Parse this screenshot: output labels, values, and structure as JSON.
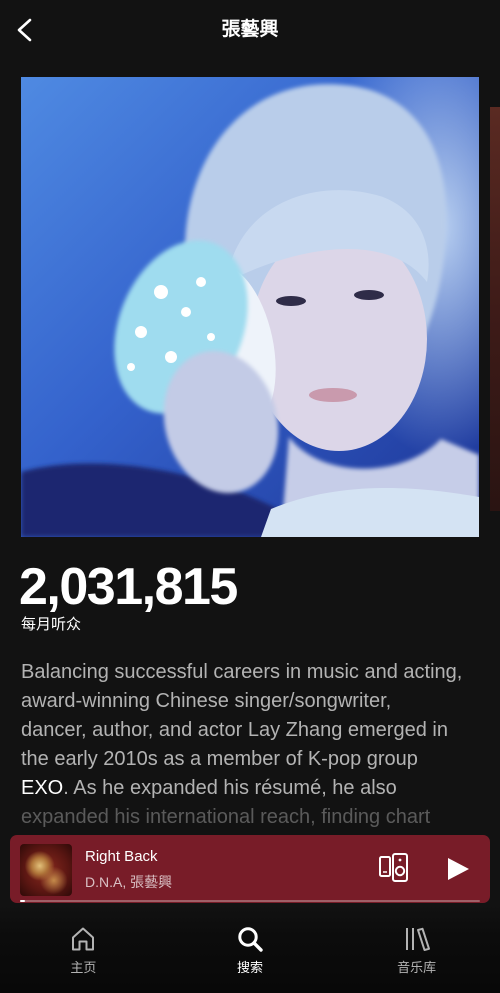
{
  "header": {
    "title": "張藝興",
    "back_icon": "chevron-left-icon"
  },
  "stats": {
    "monthly_listeners": "2,031,815",
    "monthly_listeners_label": "每月听众"
  },
  "bio": {
    "lines": [
      "Balancing successful careers in music and acting,",
      "award-winning Chinese singer/songwriter,",
      "dancer, author, and actor Lay Zhang emerged in",
      "the early 2010s as a member of K-pop group",
      {
        "link": "EXO",
        "rest": ". As he expanded his résumé, he also"
      },
      "expanded his international reach, finding chart"
    ]
  },
  "now_playing": {
    "track": "Right Back",
    "subtitle": "D.N.A, 張藝興",
    "progress": 0.01,
    "devices_icon": "devices-icon",
    "play_icon": "play-icon",
    "background_color": "#781c28"
  },
  "bottom_nav": {
    "items": [
      {
        "label": "主页",
        "icon": "home-icon",
        "active": false
      },
      {
        "label": "搜索",
        "icon": "search-icon",
        "active": true
      },
      {
        "label": "音乐库",
        "icon": "library-icon",
        "active": false
      }
    ]
  },
  "colors": {
    "background": "#121212",
    "text_primary": "#ffffff",
    "text_secondary": "#b3b3b3"
  }
}
